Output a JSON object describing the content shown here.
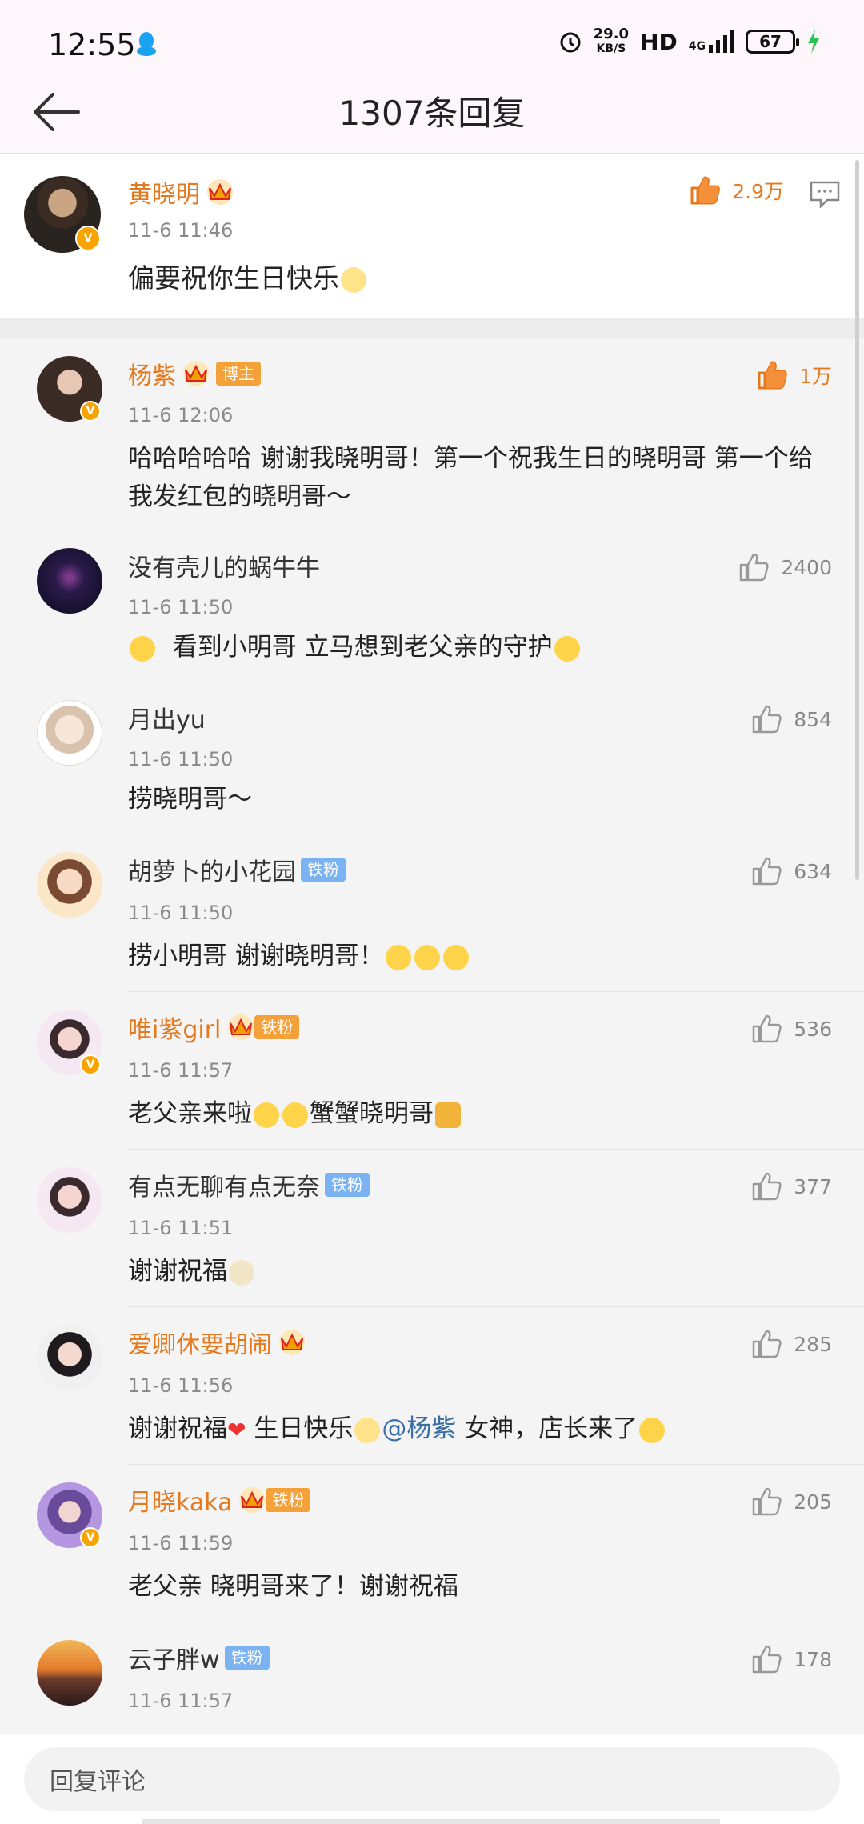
{
  "status_bar": {
    "time": "12:55",
    "speed_value": "29.0",
    "speed_unit": "KB/S",
    "hd": "HD",
    "network": "4G",
    "battery": "67"
  },
  "header": {
    "title": "1307条回复"
  },
  "main_comment": {
    "name": "黄晓明",
    "time": "11-6 11:46",
    "text": "偏要祝你生日快乐",
    "likes": "2.9万"
  },
  "comments": [
    {
      "name": "杨紫",
      "tag": "博主",
      "time": "11-6 12:06",
      "text": "哈哈哈哈哈 谢谢我晓明哥！第一个祝我生日的晓明哥 第一个给我发红包的晓明哥～",
      "likes": "1万"
    },
    {
      "name": "没有壳儿的蜗牛牛",
      "time": "11-6 11:50",
      "text": "看到小明哥  立马想到老父亲的守护",
      "likes": "2400"
    },
    {
      "name": "月出yu",
      "time": "11-6 11:50",
      "text": "捞晓明哥～",
      "likes": "854"
    },
    {
      "name": "胡萝卜的小花园",
      "tag": "铁粉",
      "time": "11-6 11:50",
      "text": "捞小明哥 谢谢晓明哥！",
      "likes": "634"
    },
    {
      "name": "唯i紫girl",
      "tag": "铁粉",
      "time": "11-6 11:57",
      "text": "老父亲来啦",
      "text2": "蟹蟹晓明哥",
      "likes": "536"
    },
    {
      "name": "有点无聊有点无奈",
      "tag": "铁粉",
      "time": "11-6 11:51",
      "text": "谢谢祝福",
      "likes": "377"
    },
    {
      "name": "爱卿休要胡闹",
      "time": "11-6 11:56",
      "text": "谢谢祝福",
      "text2": " 生日快乐",
      "mention": "@杨紫",
      "text3": "  女神，店长来了",
      "likes": "285"
    },
    {
      "name": "月晓kaka",
      "tag": "铁粉",
      "time": "11-6 11:59",
      "text": "老父亲 晓明哥来了！谢谢祝福",
      "likes": "205"
    },
    {
      "name": "云子胖w",
      "tag": "铁粉",
      "time": "11-6 11:57",
      "likes": "178"
    }
  ],
  "reply_box": {
    "placeholder": "回复评论"
  },
  "colors": {
    "accent": "#e5791d",
    "tag_blue": "#7bb2f2",
    "tag_orange": "#f5a13a",
    "verified": "#f7a400"
  }
}
